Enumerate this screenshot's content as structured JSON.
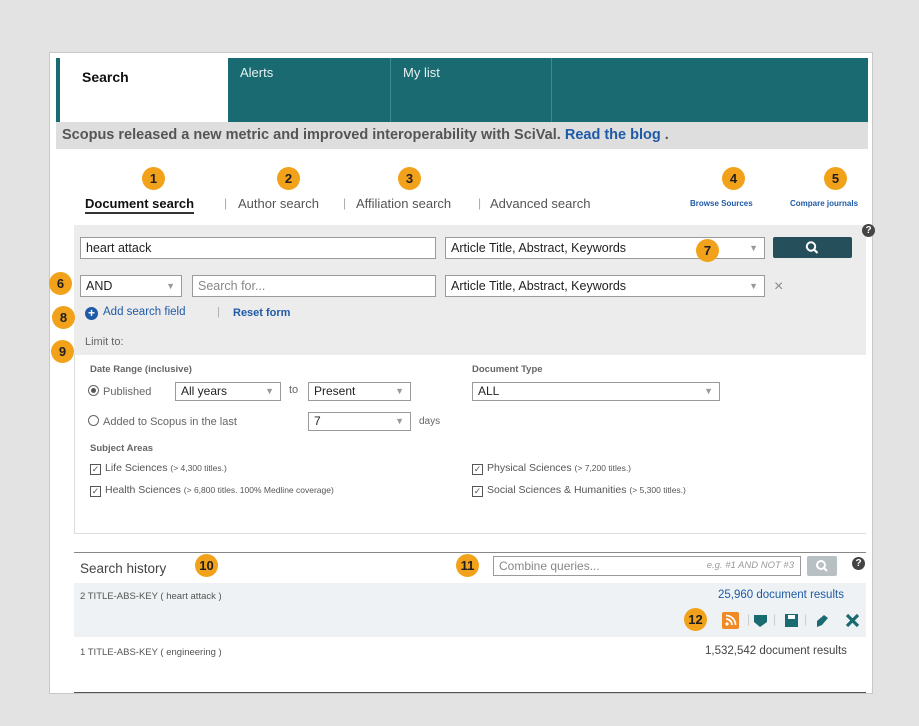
{
  "tabs": [
    {
      "label": "Search"
    },
    {
      "label": "Alerts"
    },
    {
      "label": "My list"
    }
  ],
  "banner": {
    "text": "Scopus released a new metric and improved interoperability with SciVal.",
    "link": "Read the blog",
    "suffix": " ."
  },
  "callouts": [
    "1",
    "2",
    "3",
    "4",
    "5",
    "6",
    "7",
    "8",
    "9",
    "10",
    "11",
    "12"
  ],
  "search_tabs": {
    "document": "Document search",
    "author": "Author search",
    "affiliation": "Affiliation search",
    "advanced": "Advanced search",
    "sep": "|"
  },
  "links": {
    "browse_sources": "Browse Sources",
    "compare_journals": "Compare journals"
  },
  "help": "?",
  "field1": {
    "value": "heart attack",
    "scope": "Article Title, Abstract, Keywords"
  },
  "field2": {
    "operator": "AND",
    "placeholder": "Search for...",
    "scope": "Article Title, Abstract, Keywords",
    "remove": "×"
  },
  "add_field": "Add search field",
  "reset_form": "Reset form",
  "limit_to": "Limit to:",
  "date_range": {
    "label": "Date Range (inclusive)",
    "published": "Published",
    "from": "All years",
    "to_label": "to",
    "to": "Present",
    "added": "Added to Scopus in the last",
    "days_value": "7",
    "days": "days"
  },
  "doc_type": {
    "label": "Document Type",
    "value": "ALL"
  },
  "subject_areas": {
    "label": "Subject Areas",
    "items": [
      {
        "name": "Life Sciences",
        "detail": "(> 4,300 titles.)"
      },
      {
        "name": "Health Sciences",
        "detail": "(> 6,800 titles. 100% Medline coverage)"
      },
      {
        "name": "Physical Sciences",
        "detail": "(> 7,200 titles.)"
      },
      {
        "name": "Social Sciences & Humanities",
        "detail": "(> 5,300 titles.)"
      }
    ]
  },
  "history": {
    "title": "Search history",
    "combine_placeholder": "Combine queries...",
    "combine_example": "e.g. #1 AND NOT #3",
    "rows": [
      {
        "query": "2 TITLE-ABS-KEY ( heart attack )",
        "results": "25,960 document results"
      },
      {
        "query": "1 TITLE-ABS-KEY ( engineering )",
        "results": "1,532,542 document results"
      }
    ]
  },
  "icon_colors": {
    "rss": "#f08a24",
    "action": "#1a6a72",
    "callout": "#f2a11a",
    "tabbar": "#1a6a72"
  }
}
